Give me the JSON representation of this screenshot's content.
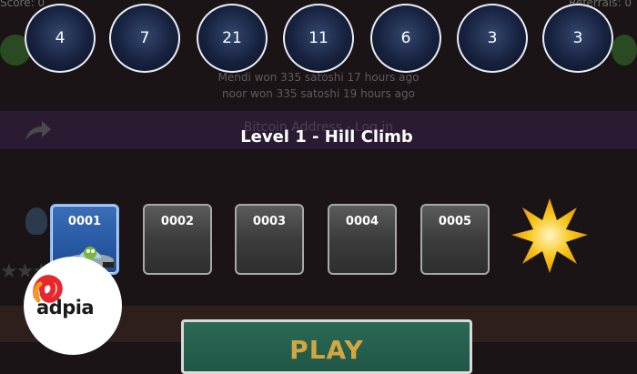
{
  "background": {
    "top_left_text": "Score: 0",
    "top_right_text": "Referrals: 0",
    "line1": "Mendi won 335 satoshi 17 hours ago",
    "line2": "noor won 335 satoshi 19 hours ago",
    "bar_text": "Bitcoin Address - Log in"
  },
  "level_numbers": [
    "4",
    "7",
    "21",
    "11",
    "6",
    "3",
    "3"
  ],
  "level_title": "Level 1 - Hill Climb",
  "slots": [
    {
      "label": "0001",
      "selected": true
    },
    {
      "label": "0002",
      "selected": false
    },
    {
      "label": "0003",
      "selected": false
    },
    {
      "label": "0004",
      "selected": false
    },
    {
      "label": "0005",
      "selected": false
    }
  ],
  "play_button": {
    "label": "PLAY"
  },
  "watermark": {
    "brand": "adpia"
  },
  "colors": {
    "circle_border": "#e9eef7",
    "selected_slot": "#285aa5",
    "play_bg": "#1f5646",
    "play_text": "#d4a640",
    "burst": "#f5c518"
  }
}
